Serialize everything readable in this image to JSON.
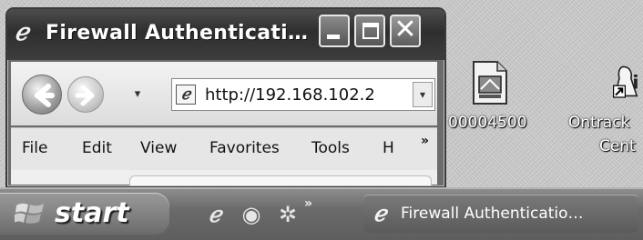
{
  "window": {
    "title": "Firewall Authenticati…",
    "icon": "ie-icon",
    "controls": {
      "minimize": "minimize-icon",
      "maximize": "maximize-icon",
      "close_glyph": "✕"
    }
  },
  "navigation": {
    "back": "back-arrow-icon",
    "forward": "forward-arrow-icon",
    "history_glyph": "▾",
    "address": {
      "value": "http://192.168.102.2",
      "dropdown_glyph": "▾"
    }
  },
  "menu": {
    "items": [
      "File",
      "Edit",
      "View",
      "Favorites",
      "Tools",
      "H"
    ],
    "overflow_glyph": "»"
  },
  "desktop_icons": [
    {
      "label_lines": [
        "00004500"
      ],
      "icon": "document-icon"
    },
    {
      "label_lines": [
        "Ontrack",
        "Cent"
      ],
      "icon": "shortcut-app-icon"
    }
  ],
  "taskbar": {
    "start_label": "start",
    "quick_launch": [
      "ie-icon",
      "media-icon",
      "tool-icon"
    ],
    "overflow_glyph": "»",
    "task": {
      "label": "Firewall Authenticatio…",
      "icon": "ie-icon"
    }
  },
  "colors": {
    "titlebar": "#3a3a3a",
    "taskbar": "#6a6a6a",
    "desktop": "#c9c9c9"
  }
}
